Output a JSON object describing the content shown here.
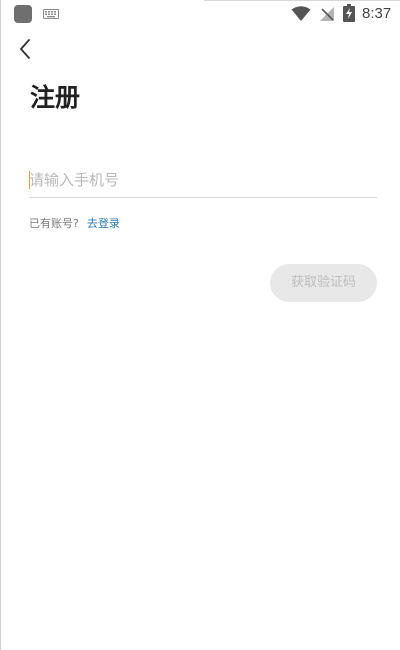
{
  "status_bar": {
    "time": "8:37",
    "icons": [
      "app-icon",
      "keyboard-icon",
      "wifi-icon",
      "no-signal-icon",
      "battery-charging-icon"
    ]
  },
  "header": {
    "back_icon": "chevron-left-icon",
    "title": "注册"
  },
  "form": {
    "phone_placeholder": "请输入手机号",
    "phone_value": "",
    "have_account_text": "已有账号?",
    "login_link": "去登录",
    "get_code_button": "获取验证码"
  },
  "colors": {
    "link": "#2b79b7",
    "button_disabled_bg": "#e8e8e8",
    "button_disabled_text": "#bdbdbd",
    "caret": "#e0a03a"
  }
}
